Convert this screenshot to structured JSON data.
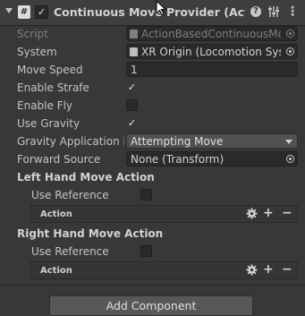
{
  "header": {
    "script_glyph": "#",
    "enabled_mark": "✓",
    "title": "Continuous Move Provider (Action-b",
    "help_glyph": "?",
    "more_glyph": "⋮"
  },
  "fields": {
    "script": {
      "label": "Script",
      "value": "ActionBasedContinuousMov"
    },
    "system": {
      "label": "System",
      "value": "XR Origin (Locomotion Syste"
    },
    "move_speed": {
      "label": "Move Speed",
      "value": "1"
    },
    "enable_strafe": {
      "label": "Enable Strafe",
      "checked": true,
      "mark": "✓"
    },
    "enable_fly": {
      "label": "Enable Fly",
      "checked": false
    },
    "use_gravity": {
      "label": "Use Gravity",
      "checked": true,
      "mark": "✓"
    },
    "gravity_application": {
      "label": "Gravity Application M",
      "value": "Attempting Move"
    },
    "forward_source": {
      "label": "Forward Source",
      "value": "None (Transform)"
    }
  },
  "left_hand": {
    "title": "Left Hand Move Action",
    "use_reference_label": "Use Reference",
    "use_reference_checked": false,
    "action_label": "Action",
    "plus_glyph": "+",
    "minus_glyph": "−"
  },
  "right_hand": {
    "title": "Right Hand Move Action",
    "use_reference_label": "Use Reference",
    "use_reference_checked": false,
    "action_label": "Action",
    "plus_glyph": "+",
    "minus_glyph": "−"
  },
  "add_component_label": "Add Component",
  "colors": {
    "background": "#383838",
    "header": "#3e3e3e",
    "field": "#2a2a2a",
    "text": "#c4c4c4"
  }
}
